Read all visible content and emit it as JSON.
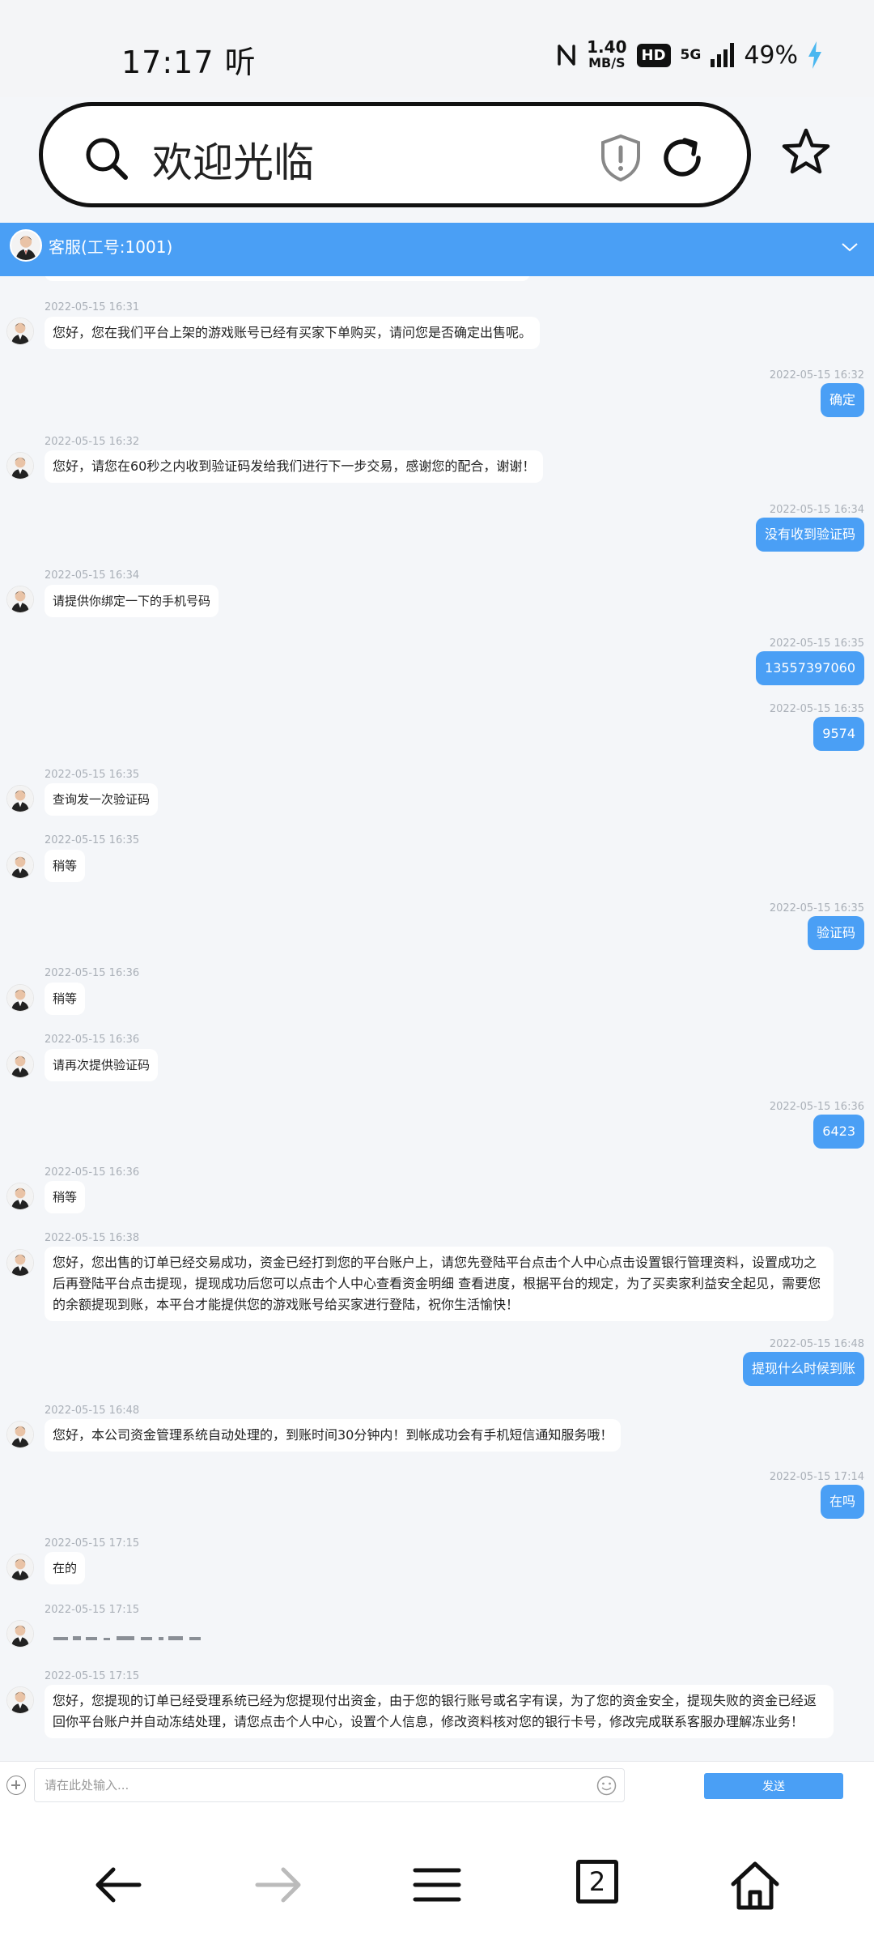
{
  "status_bar": {
    "time": "17:17",
    "time_suffix": "听",
    "speed_value": "1.40",
    "speed_unit": "MB/S",
    "hd": "HD",
    "network": "5G",
    "battery": "49%"
  },
  "browser": {
    "address_text": "欢迎光临",
    "tab_count": "2"
  },
  "chat": {
    "agent_title": "客服(工号:1001)",
    "messages": [
      {
        "side": "left",
        "time": "2022-05-15 16:31",
        "text": "您好，您在我们平台上架的游戏账号已经有买家下单购买，请问您是否确定出售呢。"
      },
      {
        "side": "right",
        "time": "2022-05-15 16:32",
        "text": "确定"
      },
      {
        "side": "left",
        "time": "2022-05-15 16:32",
        "text": "您好，请您在60秒之内收到验证码发给我们进行下一步交易，感谢您的配合，谢谢！"
      },
      {
        "side": "right",
        "time": "2022-05-15 16:34",
        "text": "没有收到验证码"
      },
      {
        "side": "left",
        "time": "2022-05-15 16:34",
        "text": "请提供你绑定一下的手机号码"
      },
      {
        "side": "right",
        "time": "2022-05-15 16:35",
        "text": "13557397060"
      },
      {
        "side": "right",
        "time": "2022-05-15 16:35",
        "text": "9574"
      },
      {
        "side": "left",
        "time": "2022-05-15 16:35",
        "text": "查询发一次验证码"
      },
      {
        "side": "left",
        "time": "2022-05-15 16:35",
        "text": "稍等"
      },
      {
        "side": "right",
        "time": "2022-05-15 16:35",
        "text": "验证码"
      },
      {
        "side": "left",
        "time": "2022-05-15 16:36",
        "text": "稍等"
      },
      {
        "side": "left",
        "time": "2022-05-15 16:36",
        "text": "请再次提供验证码"
      },
      {
        "side": "right",
        "time": "2022-05-15 16:36",
        "text": "6423"
      },
      {
        "side": "left",
        "time": "2022-05-15 16:36",
        "text": "稍等"
      },
      {
        "side": "left",
        "time": "2022-05-15 16:38",
        "text": "您好，您出售的订单已经交易成功，资金已经打到您的平台账户上，请您先登陆平台点击个人中心点击设置银行管理资料，设置成功之后再登陆平台点击提现，提现成功后您可以点击个人中心查看资金明细 查看进度，根据平台的规定，为了买卖家利益安全起见，需要您的余额提现到账，本平台才能提供您的游戏账号给买家进行登陆，祝你生活愉快！"
      },
      {
        "side": "right",
        "time": "2022-05-15 16:48",
        "text": "提现什么时候到账"
      },
      {
        "side": "left",
        "time": "2022-05-15 16:48",
        "text": "您好，本公司资金管理系统自动处理的，到账时间30分钟内！到帐成功会有手机短信通知服务哦！"
      },
      {
        "side": "right",
        "time": "2022-05-15 17:14",
        "text": "在吗"
      },
      {
        "side": "left",
        "time": "2022-05-15 17:15",
        "text": "在的"
      },
      {
        "side": "left",
        "time": "2022-05-15 17:15",
        "text": ""
      },
      {
        "side": "left",
        "time": "2022-05-15 17:15",
        "text": "您好，您提现的订单已经受理系统已经为您提现付出资金，由于您的银行账号或名字有误，为了您的资金安全，提现失败的资金已经返回你平台账户并自动冻结处理，请您点击个人中心，设置个人信息，修改资料核对您的银行卡号，修改完成联系客服办理解冻业务！"
      }
    ],
    "input_placeholder": "请在此处输入...",
    "send_label": "发送"
  },
  "colors": {
    "accent": "#4a9ff5",
    "chat_bg": "#f4f6f9"
  },
  "icons": [
    "search-icon",
    "shield-icon",
    "reload-icon",
    "star-icon",
    "chevron-down-icon",
    "plus-icon",
    "emoji-icon",
    "back-icon",
    "forward-icon",
    "menu-icon",
    "home-icon"
  ]
}
